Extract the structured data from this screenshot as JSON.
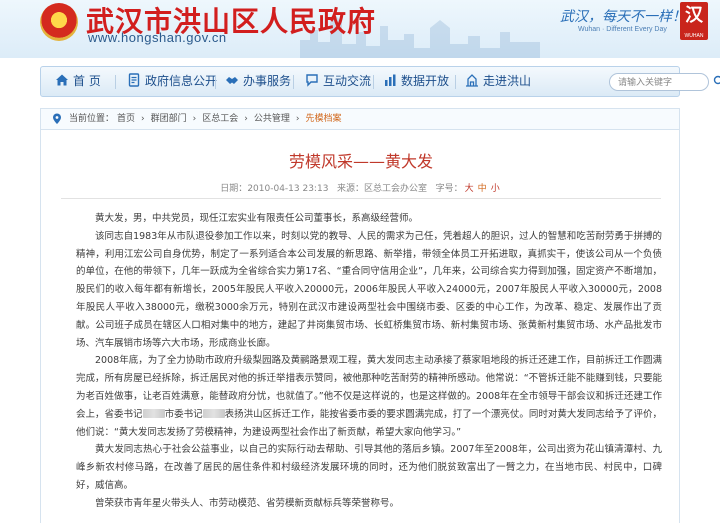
{
  "header": {
    "site_title": "武汉市洪山区人民政府",
    "site_url": "www.hongshan.gov.cn",
    "slogan": "武汉，每天不一样！",
    "slogan_en": "Wuhan · Different Every Day",
    "logo_char": "汉",
    "logo_sub": "WUHAN"
  },
  "nav": {
    "items": [
      {
        "label": "首 页",
        "icon": "home-icon"
      },
      {
        "label": "政府信息公开",
        "icon": "document-icon"
      },
      {
        "label": "办事服务",
        "icon": "handshake-icon"
      },
      {
        "label": "互动交流",
        "icon": "chat-icon"
      },
      {
        "label": "数据开放",
        "icon": "chart-icon"
      },
      {
        "label": "走进洪山",
        "icon": "building-icon"
      }
    ],
    "search_placeholder": "请输入关键字"
  },
  "breadcrumb": {
    "prefix": "当前位置：",
    "items": [
      "首页",
      "群团部门",
      "区总工会",
      "公共管理"
    ],
    "current": "先模档案",
    "separator": "›"
  },
  "article": {
    "title": "劳模风采——黄大发",
    "date_label": "日期：",
    "date": "2010-04-13 23:13",
    "source_label": "来源：",
    "source": "区总工会办公室",
    "font_label": "字号：",
    "font_sizes": [
      "大",
      "中",
      "小"
    ],
    "paragraphs": [
      "黄大发，男，中共党员，现任江宏实业有限责任公司董事长，系高级经营师。",
      "该同志自1983年从市队退役参加工作以来，时刻以党的教导、人民的需求为己任，凭着超人的胆识，过人的智慧和吃苦耐劳勇于拼搏的精神，利用江宏公司自身优势，制定了一系列适合本公司发展的新思路、新举措，带领全体员工开拓进取，真抓实干，使该公司从一个负债的单位，在他的带领下，几年一跃成为全省综合实力第17名、“重合同守信用企业”，几年来，公司综合实力得到加强，固定资产不断增加，股民们的收入每年都有新增长，2005年股民人平收入20000元，2006年股民人平收入24000元，2007年股民人平收入30000元，2008年股民人平收入38000元，缴税3000余万元，特别在武汉市建设两型社会中围绕市委、区委的中心工作，为改革、稳定、发展作出了贡献。公司班子成员在辖区人口相对集中的地方，建起了井岗集贸市场、长虹桥集贸市场、新村集贸市场、张黄新村集贸市场、水产品批发市场、汽车展销市场等六大市场，形成商业长廊。",
      "2008年底，为了全力协助市政府升级梨园路及黄鹂路景观工程，黄大发同志主动承接了蔡家咀地段的拆迁还建工作，目前拆迁工作圆满完成，所有房屋已经拆除，拆迁居民对他的拆迁举措表示赞同，被他那种吃苦耐劳的精神所感动。他常说：“不管拆迁能不能赚到钱，只要能为老百姓做事，让老百姓满意，能替政府分忧，也就值了。”他不仅是这样说的，也是这样做的。2008年在全市领导干部会议和拆迁还建工作会上，省委书记",
      "市委书记",
      "表扬洪山区拆迁工作，能按省委市委的要求圆满完成，打了一个漂亮仗。同时对黄大发同志给予了评价，他们说：“黄大发同志发扬了劳模精神，为建设两型社会作出了新贡献，希望大家向他学习。”",
      "黄大发同志热心于社会公益事业，以自己的实际行动去帮助、引导其他的落后乡镇。2007年至2008年，公司出资为花山镇清潭村、九峰乡新农村修马路，在改善了居民的居住条件和村级经济发展环境的同时，还为他们脱贫致富出了一臂之力，在当地市民、村民中，口碑好，威信高。",
      "曾荣获市青年星火带头人、市劳动模范、省劳模新贡献标兵等荣誉称号。"
    ]
  },
  "colors": {
    "site_title": "#d21e1e",
    "nav_text": "#1d4f8c",
    "article_title": "#c0392b",
    "breadcrumb_current": "#d2691e"
  }
}
